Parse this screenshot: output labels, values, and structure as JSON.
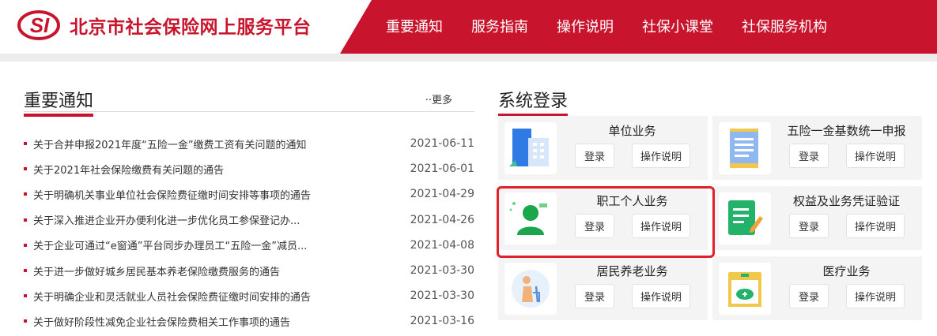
{
  "header": {
    "logo_text": "SI",
    "site_title": "北京市社会保险网上服务平台",
    "nav": [
      "重要通知",
      "服务指南",
      "操作说明",
      "社保小课堂",
      "社保服务机构"
    ],
    "colors": {
      "brand_red": "#c8152d",
      "highlight_red": "#e0202b"
    }
  },
  "notices": {
    "title": "重要通知",
    "more_label": "··更多",
    "items": [
      {
        "text": "关于合并申报2021年度“五险一金”缴费工资有关问题的通知",
        "date": "2021-06-11"
      },
      {
        "text": "关于2021年社会保险缴费有关问题的通告",
        "date": "2021-06-01"
      },
      {
        "text": "关于明确机关事业单位社会保险费征缴时间安排等事项的通告",
        "date": "2021-04-29"
      },
      {
        "text": "关于深入推进企业开办便利化进一步优化员工参保登记办...",
        "date": "2021-04-26"
      },
      {
        "text": "关于企业可通过“e窗通”平台同步办理员工“五险一金”减员...",
        "date": "2021-04-08"
      },
      {
        "text": "关于进一步做好城乡居民基本养老保险缴费服务的通告",
        "date": "2021-03-30"
      },
      {
        "text": "关于明确企业和灵活就业人员社会保险费征缴时间安排的通告",
        "date": "2021-03-30"
      },
      {
        "text": "关于做好阶段性减免企业社会保险费相关工作事项的通告",
        "date": "2021-03-16"
      }
    ]
  },
  "login": {
    "title": "系统登录",
    "login_label": "登录",
    "guide_label": "操作说明",
    "cards": [
      {
        "title": "单位业务",
        "icon": "building-icon"
      },
      {
        "title": "五险一金基数统一申报",
        "icon": "document-icon"
      },
      {
        "title": "职工个人业务",
        "icon": "person-icon"
      },
      {
        "title": "权益及业务凭证验证",
        "icon": "verify-icon"
      },
      {
        "title": "居民养老业务",
        "icon": "elderly-icon"
      },
      {
        "title": "医疗业务",
        "icon": "medical-icon"
      }
    ]
  }
}
